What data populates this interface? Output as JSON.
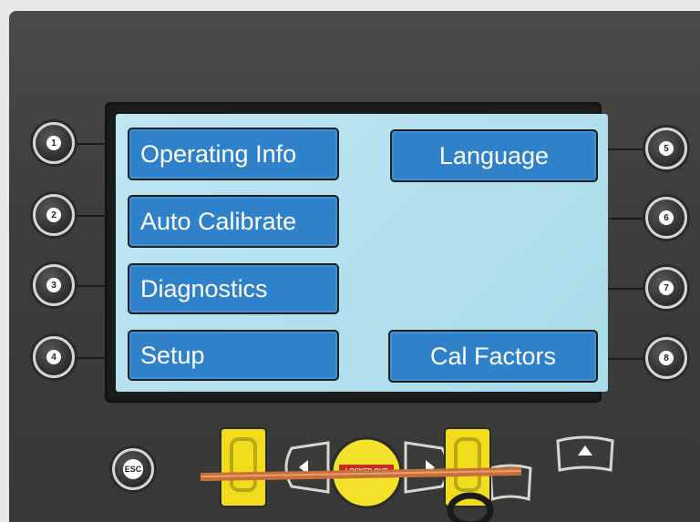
{
  "menu": {
    "left": [
      {
        "label": "Operating Info"
      },
      {
        "label": "Auto Calibrate"
      },
      {
        "label": "Diagnostics"
      },
      {
        "label": "Setup"
      }
    ],
    "right": [
      {
        "label": "Language"
      },
      {
        "label": "Cal Factors"
      }
    ]
  },
  "softkeys": {
    "left": [
      "1",
      "2",
      "3",
      "4"
    ],
    "right": [
      "5",
      "6",
      "7",
      "8"
    ]
  },
  "esc_label": "ESC",
  "lockout_tag": "LOCKED OUT",
  "colors": {
    "screen": "#b8e2f0",
    "menu_button": "#2f82c9",
    "panel": "#3f3f3d",
    "lock_yellow": "#f3e12a"
  }
}
